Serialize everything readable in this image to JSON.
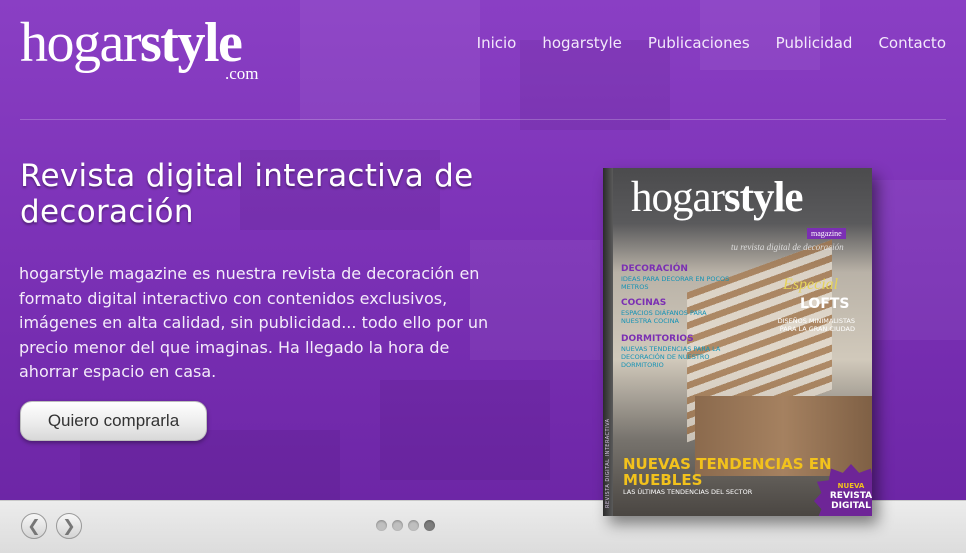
{
  "logo": {
    "brand_regular": "hogar",
    "brand_bold": "style",
    "tld": ".com"
  },
  "nav": [
    "Inicio",
    "hogarstyle",
    "Publicaciones",
    "Publicidad",
    "Contacto"
  ],
  "hero": {
    "headline": "Revista digital interactiva de decoración",
    "description": "hogarstyle magazine es nuestra revista de decoración en formato digital interactivo con contenidos exclusivos, imágenes en alta calidad, sin publicidad... todo ello por un precio menor del que imaginas. Ha llegado la hora de ahorrar espacio en casa.",
    "cta_label": "Quiero comprarla"
  },
  "slider": {
    "prev_icon": "arrow-left-icon",
    "next_icon": "arrow-right-icon",
    "dot_count": 4,
    "active_dot": 4
  },
  "magazine": {
    "logo_regular": "hogar",
    "logo_bold": "style",
    "badge": "magazine",
    "tagline": "tu revista digital de decoración",
    "spine": "REVISTA DIGITAL INTERACTIVA",
    "sections": [
      {
        "title": "DECORACIÓN",
        "sub": "IDEAS PARA DECORAR EN POCOS METROS"
      },
      {
        "title": "COCINAS",
        "sub": "ESPACIOS DIÁFANOS PARA NUESTRA COCINA"
      },
      {
        "title": "DORMITORIOS",
        "sub": "NUEVAS TENDENCIAS PARA LA DECORACIÓN DE NUESTRO DORMITORIO"
      }
    ],
    "especial": "Especial",
    "lofts": "LOFTS",
    "lofts_sub": "DISEÑOS MINIMALISTAS PARA LA GRAN CIUDAD",
    "headline": "NUEVAS TENDENCIAS EN MUEBLES",
    "headline_sub": "LAS ÚLTIMAS TENDENCIAS DEL SECTOR",
    "burst_top": "NUEVA",
    "burst_main": "REVISTA DIGITAL"
  },
  "colors": {
    "brand_purple": "#7e2fb6",
    "accent_yellow": "#f2c21c",
    "cyan_sub": "#1493b6"
  }
}
